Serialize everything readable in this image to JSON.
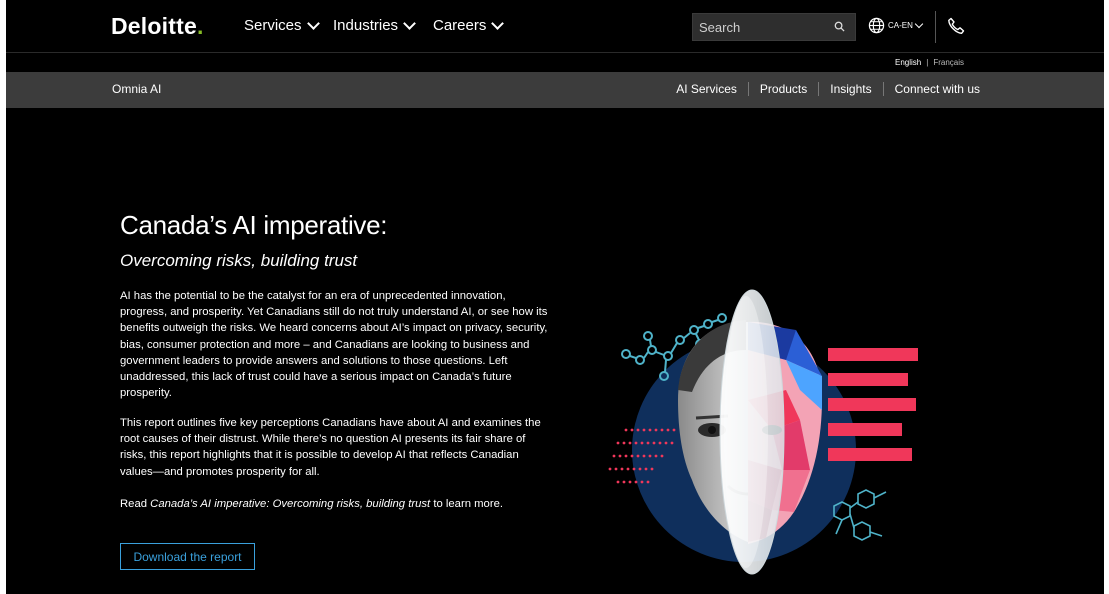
{
  "header": {
    "logo": "Deloitte",
    "logo_dot": ".",
    "nav": [
      {
        "label": "Services"
      },
      {
        "label": "Industries"
      },
      {
        "label": "Careers"
      }
    ],
    "search_placeholder": "Search",
    "locale": "CA-EN",
    "icons": [
      "search-icon",
      "globe-icon",
      "phone-icon",
      "chevron-down-icon"
    ]
  },
  "lang": {
    "english": "English",
    "separator": "|",
    "french": "Français"
  },
  "subnav": {
    "brand": "Omnia AI",
    "links": [
      "AI Services",
      "Products",
      "Insights",
      "Connect with us"
    ]
  },
  "hero": {
    "title": "Canada’s AI imperative:",
    "subtitle": "Overcoming risks, building trust",
    "paragraph1": "AI has the potential to be the catalyst for an era of unprecedented innovation, progress, and prosperity. Yet Canadians still do not truly understand AI, or see how its benefits outweigh the risks. We heard concerns about AI’s impact on privacy, security, bias, consumer protection and more – and Canadians are looking to business and government leaders to provide answers and solutions to those questions. Left unaddressed, this lack of trust could have a serious impact on Canada’s future prosperity.",
    "paragraph2": "This report outlines five key perceptions Canadians have about AI and examines the root causes of their distrust. While there’s no question AI presents its fair share of risks, this report highlights that it is possible to develop AI that reflects Canadian values—and promotes prosperity for all.",
    "paragraph3_prefix": "Read ",
    "paragraph3_italic": "Canada’s AI imperative: Overcoming risks, building trust",
    "paragraph3_suffix": " to learn more.",
    "button": "Download the report"
  },
  "colors": {
    "background": "#000000",
    "subnav": "#3c3c3c",
    "accent_green": "#86bc25",
    "link_blue": "#3aa0dc",
    "art_red": "#f0375a",
    "art_navy": "#0f2f5c"
  }
}
